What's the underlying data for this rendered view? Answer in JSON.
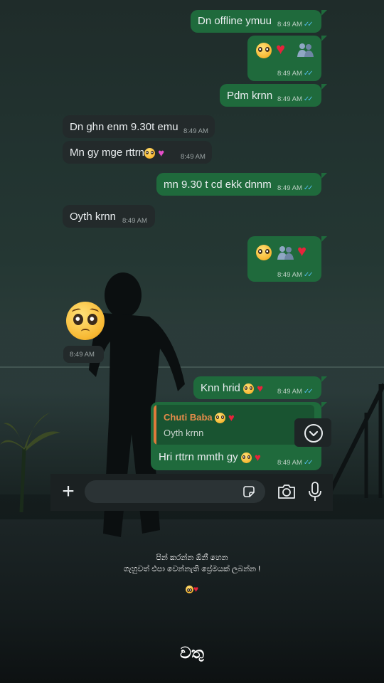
{
  "messages": [
    {
      "id": "m1",
      "text": "Dn offline ymuu",
      "time": "8:49 AM",
      "dir": "out"
    },
    {
      "id": "m2",
      "text": "",
      "time": "8:49 AM",
      "dir": "out",
      "emojis": [
        "pleading-face",
        "red-heart",
        "people-silhouette"
      ]
    },
    {
      "id": "m3",
      "text": "Pdm krnn",
      "time": "8:49 AM",
      "dir": "out"
    },
    {
      "id": "m4",
      "text": "Dn ghn enm 9.30t emu",
      "time": "8:49 AM",
      "dir": "in"
    },
    {
      "id": "m5",
      "text": "Mn gy mge rttrn",
      "time": "8:49 AM",
      "dir": "in",
      "emojis": [
        "pleading-face",
        "pink-heart"
      ]
    },
    {
      "id": "m6",
      "text": "mn 9.30 t cd ekk dnnm",
      "time": "8:49 AM",
      "dir": "out"
    },
    {
      "id": "m7",
      "text": "Oyth krnn",
      "time": "8:49 AM",
      "dir": "in"
    },
    {
      "id": "m8",
      "text": "",
      "time": "8:49 AM",
      "dir": "out",
      "emojis": [
        "pleading-face",
        "people-silhouette",
        "red-heart"
      ]
    },
    {
      "id": "m9",
      "text": "",
      "time": "8:49 AM",
      "dir": "in",
      "emojis": [
        "pleading-face-large"
      ]
    },
    {
      "id": "m10",
      "text": "Knn hrid",
      "time": "8:49 AM",
      "dir": "out",
      "emojis": [
        "pleading-face",
        "red-heart"
      ]
    },
    {
      "id": "m11",
      "text": "Hri rttrn mmth gy",
      "time": "8:49 AM",
      "dir": "out",
      "emojis": [
        "pleading-face",
        "red-heart"
      ]
    }
  ],
  "reply_quote": {
    "name": "Chuti Baba",
    "text": "Oyth krnn",
    "accent": "#e07a3a"
  },
  "input_bar": {
    "placeholder": "",
    "icons": [
      "plus-icon",
      "sticker-icon",
      "camera-icon",
      "mic-icon"
    ]
  },
  "scroll_button": {
    "icon": "chevron-down-icon"
  },
  "caption": {
    "line1": "පින් කරන්න ඕනී හෙන",
    "line2": "ගැහුවත් එපා වෙන්නැති ප්‍රේමයක් ලබන්න !",
    "line3_emojis": [
      "relieved-face",
      "red-heart"
    ]
  },
  "watermark": "වතු",
  "colors": {
    "outgoing_bubble": "#1f6a3c",
    "incoming_bubble": "#232a2b",
    "read_tick": "#53bdeb"
  }
}
